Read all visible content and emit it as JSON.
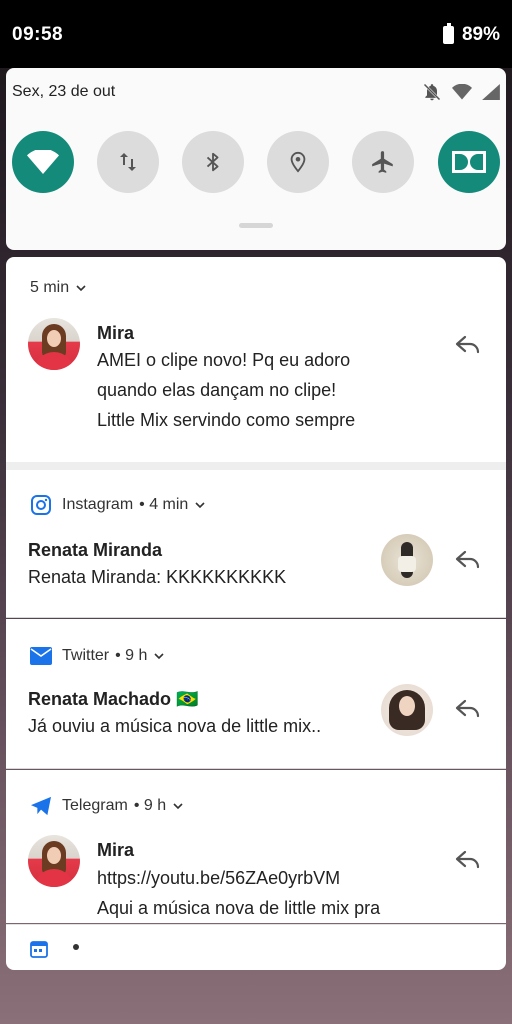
{
  "status_bar": {
    "time": "09:58",
    "battery": "89%"
  },
  "quick_settings": {
    "date": "Sex, 23 de out",
    "sys_icons": [
      "bell-off-icon",
      "wifi-signal-icon",
      "cell-signal-icon"
    ],
    "tiles": [
      {
        "name": "wifi-tile",
        "icon": "wifi-icon",
        "state": "on"
      },
      {
        "name": "mobile-data-tile",
        "icon": "data-arrows-icon",
        "state": "off"
      },
      {
        "name": "bluetooth-tile",
        "icon": "bluetooth-icon",
        "state": "off"
      },
      {
        "name": "location-tile",
        "icon": "location-pin-icon",
        "state": "off"
      },
      {
        "name": "airplane-tile",
        "icon": "airplane-icon",
        "state": "off"
      },
      {
        "name": "dolby-tile",
        "icon": "dolby-icon",
        "state": "on"
      }
    ],
    "accent": "#148b7a"
  },
  "notifications": [
    {
      "time": "5 min",
      "sender": "Mira",
      "lines": [
        "AMEI o clipe novo! Pq eu adoro",
        "quando elas dançam no clipe!",
        "Little Mix servindo como sempre"
      ]
    },
    {
      "app": "Instagram",
      "time": "• 4 min",
      "sender": "Renata Miranda",
      "lines": [
        "Renata Miranda: KKKKKKKKKK"
      ],
      "app_color": "#1a73e8"
    },
    {
      "app": "Twitter",
      "time": "• 9 h",
      "sender": "Renata Machado 🇧🇷",
      "lines": [
        "Já ouviu a música nova de little mix.."
      ],
      "app_color": "#1a73e8"
    },
    {
      "app": "Telegram",
      "time": "• 9 h",
      "sender": "Mira",
      "lines": [
        "https://youtu.be/56ZAe0yrbVM",
        "Aqui a música nova de little mix pra"
      ],
      "app_color": "#1a73e8"
    }
  ],
  "footer": {
    "icon": "calendar-icon",
    "dot": "•"
  }
}
